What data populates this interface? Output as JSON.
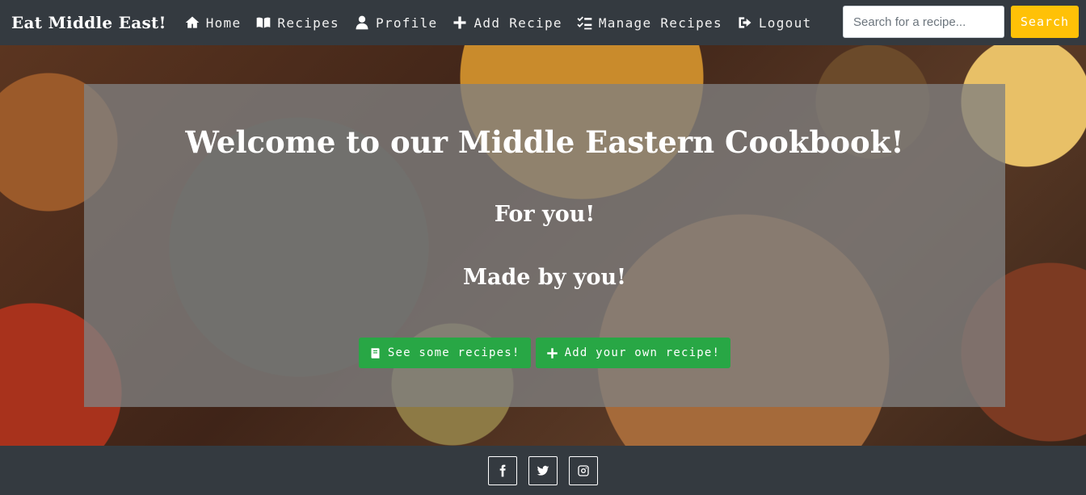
{
  "brand": "Eat Middle East!",
  "nav": [
    {
      "label": "Home",
      "icon": "home-icon"
    },
    {
      "label": "Recipes",
      "icon": "book-open-icon"
    },
    {
      "label": "Profile",
      "icon": "user-icon"
    },
    {
      "label": "Add Recipe",
      "icon": "plus-icon"
    },
    {
      "label": "Manage Recipes",
      "icon": "tasks-icon"
    },
    {
      "label": "Logout",
      "icon": "sign-out-icon"
    }
  ],
  "search": {
    "placeholder": "Search for a recipe...",
    "button_label": "Search"
  },
  "hero": {
    "title": "Welcome to our Middle Eastern Cookbook!",
    "subtitle1": "For you!",
    "subtitle2": "Made by you!",
    "buttons": [
      {
        "label": "See some recipes!",
        "icon": "book-icon"
      },
      {
        "label": "Add your own recipe!",
        "icon": "plus-icon"
      }
    ]
  },
  "footer": {
    "social": [
      "facebook-icon",
      "twitter-icon",
      "instagram-icon"
    ]
  },
  "colors": {
    "navbar": "#343a40",
    "search_button": "#ffc107",
    "hero_buttons": "#28a745"
  }
}
